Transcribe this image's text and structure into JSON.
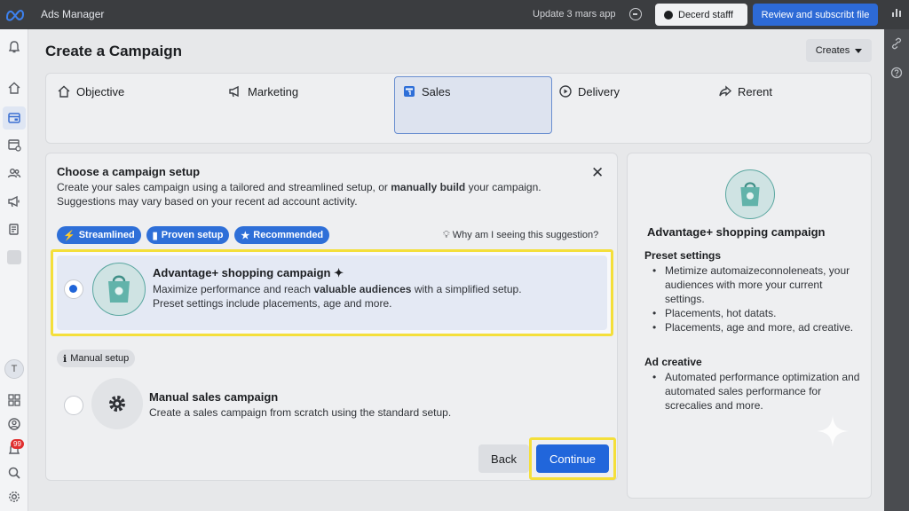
{
  "topbar": {
    "app_title": "Ads Manager",
    "update_text": "Update 3 mars app",
    "decerd_button": "Decerd stafff",
    "review_button": "Review and subscribt file"
  },
  "leftrail": {
    "notification_count": "99",
    "avatar_letter": "T"
  },
  "header": {
    "page_title": "Create a Campaign",
    "creates_button": "Creates"
  },
  "steps": [
    {
      "label": "Objective",
      "icon": "home-icon"
    },
    {
      "label": "Marketing",
      "icon": "megaphone-icon"
    },
    {
      "label": "Sales",
      "icon": "sales-icon"
    },
    {
      "label": "Delivery",
      "icon": "play-circle-icon"
    },
    {
      "label": "Rerent",
      "icon": "share-icon"
    }
  ],
  "active_step": "Sales",
  "setup": {
    "title": "Choose a campaign setup",
    "desc_part1": "Create your sales campaign using a tailored and streamlined setup, or ",
    "desc_bold": "manually build",
    "desc_part2": " your campaign. Suggestions may vary based on your recent ad account activity.",
    "chips": [
      "Streamlined",
      "Proven setup",
      "Recommended"
    ],
    "why_text": "Why am I seeing this suggestion?",
    "advantage": {
      "title": "Advantage+ shopping campaign",
      "desc_part1": "Maximize performance and reach ",
      "desc_bold": "valuable audiences",
      "desc_part2": " with a simplified setup.",
      "desc_line2": "Preset settings include placements, age and more.",
      "selected": true
    },
    "manual_pill": "Manual setup",
    "manual": {
      "title": "Manual sales campaign",
      "desc": "Create a sales campaign from scratch using the standard setup.",
      "selected": false
    },
    "back_button": "Back",
    "continue_button": "Continue"
  },
  "side": {
    "title": "Advantage+ shopping campaign",
    "preset_heading": "Preset settings",
    "preset_items": [
      "Metimize automaizeconnoleneats, your audiences with more your current settings.",
      "Placements, hot datats.",
      "Placements, age and more, ad creative."
    ],
    "creative_heading": "Ad creative",
    "creative_items": [
      "Automated performance optimization and automated sales performance for screcalies and more."
    ]
  },
  "colors": {
    "accent": "#2166db",
    "highlight": "#f4df3a",
    "bag_teal": "#5aa7a0"
  }
}
